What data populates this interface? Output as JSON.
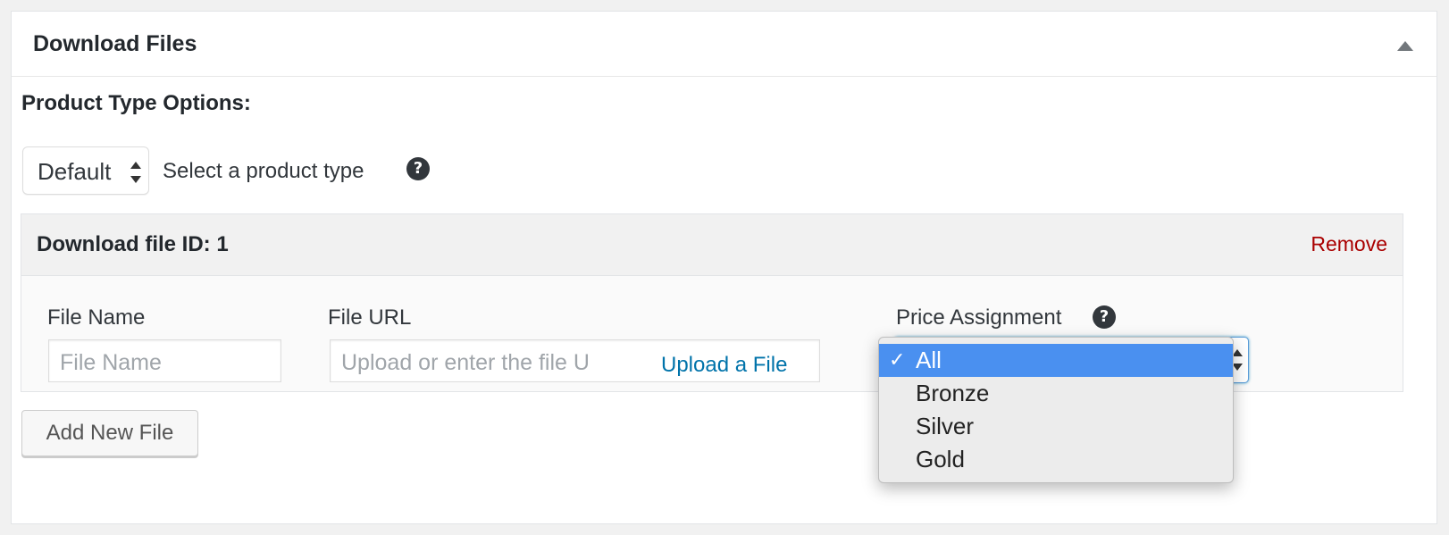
{
  "panel": {
    "title": "Download Files",
    "collapse_icon": "triangle-up-icon"
  },
  "product_type": {
    "label": "Product Type Options:",
    "selected": "Default",
    "hint": "Select a product type",
    "help": "?"
  },
  "file": {
    "header": "Download file ID: 1",
    "remove_label": "Remove",
    "name_label": "File Name",
    "name_placeholder": "File Name",
    "url_label": "File URL",
    "url_placeholder": "Upload or enter the file U",
    "upload_label": "Upload a File",
    "price_label": "Price Assignment",
    "price_help": "?"
  },
  "price_dropdown": {
    "selected": "All",
    "check": "✓",
    "options": [
      "All",
      "Bronze",
      "Silver",
      "Gold"
    ]
  },
  "add_button": "Add New File",
  "colors": {
    "link": "#0073aa",
    "remove": "#aa0000",
    "selected_option": "#4a90f0"
  }
}
